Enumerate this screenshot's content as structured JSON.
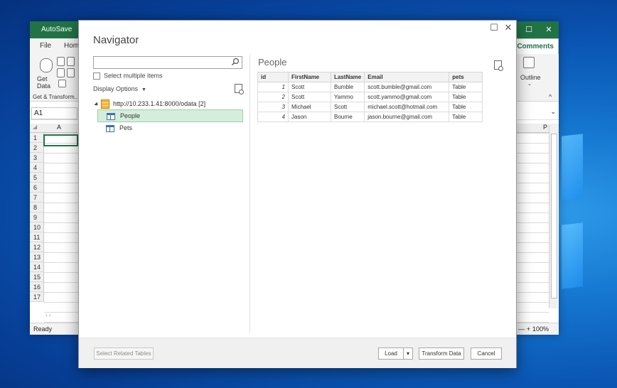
{
  "excel": {
    "autosave_label": "AutoSave",
    "menu": [
      "File",
      "Hom"
    ],
    "comments_label": "Comments",
    "get_data_label": "Get\nData",
    "group_label": "Get & Transform...",
    "outline_label": "Outline",
    "name_box": "A1",
    "column_a": "A",
    "column_p": "P",
    "rows": [
      "1",
      "2",
      "3",
      "4",
      "5",
      "6",
      "7",
      "8",
      "9",
      "10",
      "11",
      "12",
      "13",
      "14",
      "15",
      "16",
      "17"
    ],
    "status": "Ready",
    "zoom": "100%",
    "zoom_minus_plus": "— +"
  },
  "navigator": {
    "title": "Navigator",
    "search_placeholder": "",
    "select_multiple": "Select multiple items",
    "display_options": "Display Options",
    "source": {
      "url": "http://10.233.1.41:8000/odata",
      "count": "[2]"
    },
    "items": [
      {
        "label": "People",
        "selected": true
      },
      {
        "label": "Pets",
        "selected": false
      }
    ],
    "preview": {
      "title": "People",
      "columns": [
        "id",
        "FirstName",
        "LastName",
        "Email",
        "pets"
      ],
      "rows": [
        [
          "1",
          "Scott",
          "Bumble",
          "scott.bumble@gmail.com",
          "Table"
        ],
        [
          "2",
          "Scott",
          "Yammo",
          "scott.yammo@gmail.com",
          "Table"
        ],
        [
          "3",
          "Michael",
          "Scott",
          "michael.scott@hotmail.com",
          "Table"
        ],
        [
          "4",
          "Jason",
          "Bourne",
          "jason.bourne@gmail.com",
          "Table"
        ]
      ]
    },
    "buttons": {
      "select_related": "Select Related Tables",
      "load": "Load",
      "transform": "Transform Data",
      "cancel": "Cancel"
    }
  },
  "colors": {
    "excel_green": "#217346",
    "selected_row": "#d5eedb"
  }
}
